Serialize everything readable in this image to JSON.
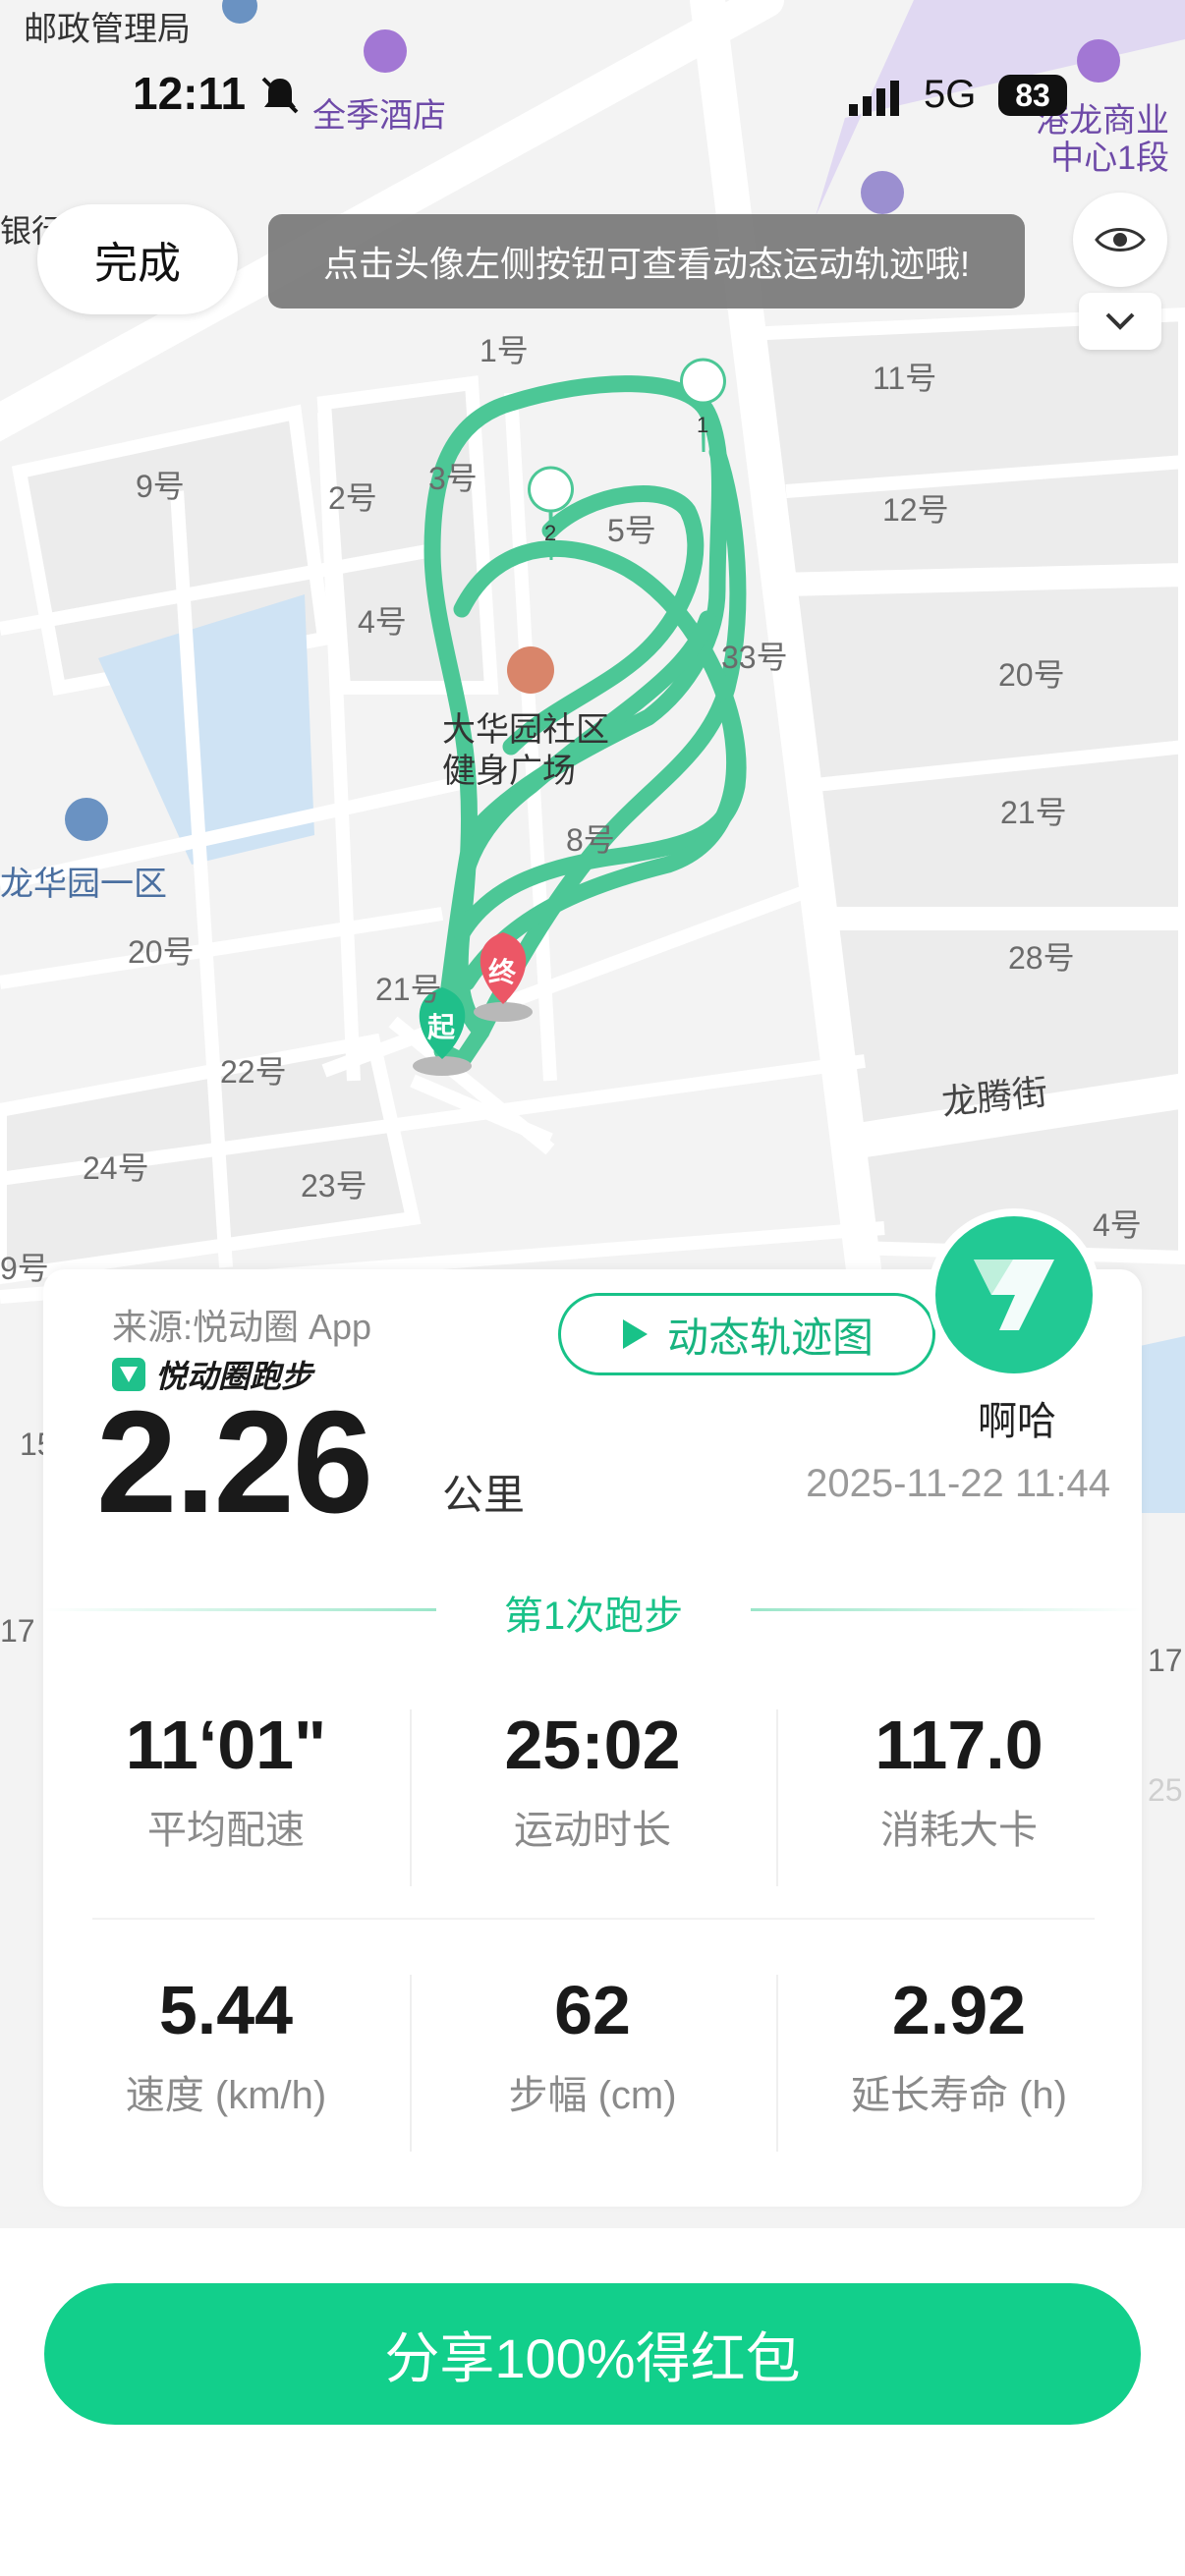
{
  "status_bar": {
    "time": "12:11",
    "network": "5G",
    "battery": "83"
  },
  "map": {
    "labels": [
      "邮政管理局",
      "银行",
      "1号",
      "9号",
      "2号",
      "3号",
      "5号",
      "11号",
      "12号",
      "4号",
      "33号",
      "20号",
      "21号",
      "28号",
      "8号",
      "龙华园一区",
      "20号",
      "21号",
      "22号",
      "24号",
      "23号",
      "4号",
      "9号",
      "15",
      "17",
      "17",
      "25",
      "龙腾街"
    ],
    "pois": [
      "全季酒店",
      "港龙商业中心1段",
      "大华园社区健身广场"
    ],
    "markers": {
      "start": "起",
      "end": "终",
      "km1": "1",
      "km2": "2"
    },
    "colors": {
      "route": "#4cc796",
      "start": "#20bf8a",
      "end": "#ec5766"
    }
  },
  "top": {
    "done_label": "完成",
    "toast": "点击头像左侧按钮可查看动态运动轨迹哦!"
  },
  "card": {
    "source": "来源:悦动圈 App",
    "brand": "悦动圈跑步",
    "trail_button": "动态轨迹图",
    "nickname": "啊哈",
    "distance": "2.26",
    "distance_unit": "公里",
    "datetime": "2025-11-22 11:44",
    "run_title": "第1次跑步",
    "stats": [
      {
        "value": "11‘01\"",
        "label": "平均配速"
      },
      {
        "value": "25:02",
        "label": "运动时长"
      },
      {
        "value": "117.0",
        "label": "消耗大卡"
      },
      {
        "value": "5.44",
        "label": "速度 (km/h)"
      },
      {
        "value": "62",
        "label": "步幅 (cm)"
      },
      {
        "value": "2.92",
        "label": "延长寿命 (h)"
      }
    ]
  },
  "share_button": "分享100%得红包",
  "accent": "#12cf8b"
}
